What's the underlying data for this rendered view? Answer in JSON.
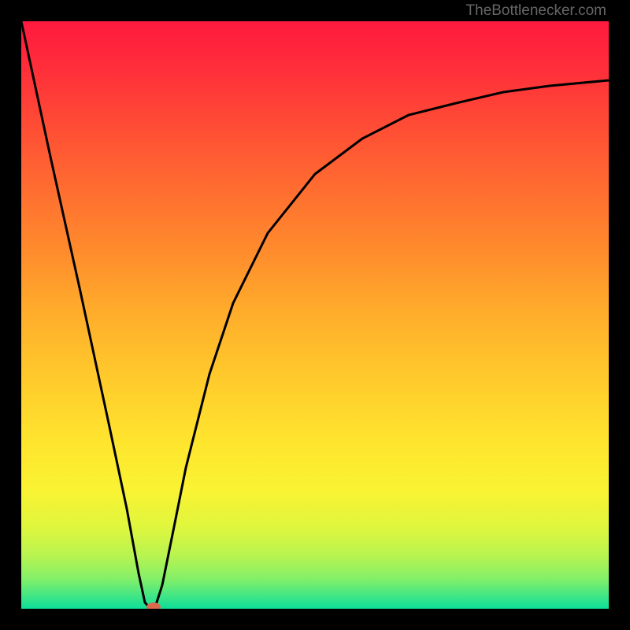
{
  "attribution": "TheBottlenecker.com",
  "chart_data": {
    "type": "line",
    "title": "",
    "xlabel": "",
    "ylabel": "",
    "xlim": [
      0,
      100
    ],
    "ylim": [
      0,
      100
    ],
    "series": [
      {
        "name": "bottleneck-curve",
        "description": "V-shaped curve with minimum near x=22",
        "points": [
          {
            "x": 0,
            "y": 100
          },
          {
            "x": 5,
            "y": 77
          },
          {
            "x": 10,
            "y": 54
          },
          {
            "x": 15,
            "y": 31
          },
          {
            "x": 18,
            "y": 17
          },
          {
            "x": 20,
            "y": 6
          },
          {
            "x": 21,
            "y": 1
          },
          {
            "x": 22,
            "y": 0
          },
          {
            "x": 23,
            "y": 1
          },
          {
            "x": 24,
            "y": 4
          },
          {
            "x": 26,
            "y": 14
          },
          {
            "x": 28,
            "y": 24
          },
          {
            "x": 32,
            "y": 40
          },
          {
            "x": 36,
            "y": 52
          },
          {
            "x": 42,
            "y": 64
          },
          {
            "x": 50,
            "y": 74
          },
          {
            "x": 58,
            "y": 80
          },
          {
            "x": 66,
            "y": 84
          },
          {
            "x": 74,
            "y": 86
          },
          {
            "x": 82,
            "y": 88
          },
          {
            "x": 90,
            "y": 89
          },
          {
            "x": 100,
            "y": 90
          }
        ]
      }
    ],
    "marker": {
      "x": 22,
      "y": 0,
      "color": "#d96a4e"
    },
    "background_gradient": {
      "type": "vertical",
      "stops": [
        {
          "position": 0,
          "color": "#ff1a3e"
        },
        {
          "position": 50,
          "color": "#ffbe2b"
        },
        {
          "position": 80,
          "color": "#f9f333"
        },
        {
          "position": 100,
          "color": "#0dde9a"
        }
      ]
    }
  }
}
